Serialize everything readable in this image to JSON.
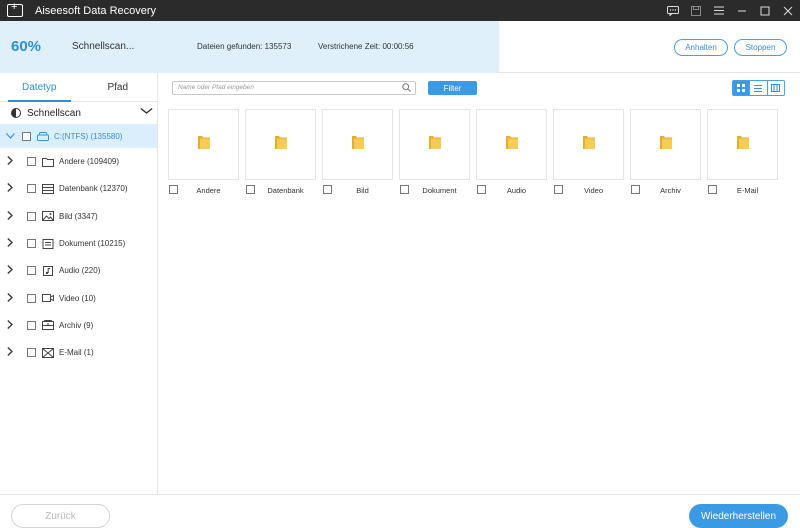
{
  "app": {
    "title": "Aiseesoft Data Recovery"
  },
  "scan": {
    "percent_label": "60%",
    "progress": 0.6,
    "status": "Schnellscan...",
    "found": "Dateien gefunden: 135573",
    "elapsed": "Verstrichene Zeit: 00:00:56",
    "pause_label": "Anhalten",
    "stop_label": "Stoppen"
  },
  "sidebar": {
    "tabs": [
      {
        "label": "Datetyp",
        "active": true
      },
      {
        "label": "Pfad",
        "active": false
      }
    ],
    "scan_mode": "Schnellscan",
    "drive": "C:(NTFS) (135580)",
    "items": [
      {
        "label": "Andere (109409)",
        "icon": "folder-icon"
      },
      {
        "label": "Datenbank (12370)",
        "icon": "database-icon"
      },
      {
        "label": "Bild (3347)",
        "icon": "image-icon"
      },
      {
        "label": "Dokument (10215)",
        "icon": "document-icon"
      },
      {
        "label": "Audio (220)",
        "icon": "audio-icon"
      },
      {
        "label": "Video (10)",
        "icon": "video-icon"
      },
      {
        "label": "Archiv (9)",
        "icon": "archive-icon"
      },
      {
        "label": "E-Mail (1)",
        "icon": "email-icon"
      }
    ]
  },
  "toolbar": {
    "search_placeholder": "Name oder Pfad eingeben",
    "filter_label": "Filter"
  },
  "tiles": [
    {
      "label": "Andere"
    },
    {
      "label": "Datenbank"
    },
    {
      "label": "Bild"
    },
    {
      "label": "Dokument"
    },
    {
      "label": "Audio"
    },
    {
      "label": "Video"
    },
    {
      "label": "Archiv"
    },
    {
      "label": "E-Mail"
    }
  ],
  "footer": {
    "back_label": "Zurück",
    "recover_label": "Wiederherstellen"
  },
  "colors": {
    "accent": "#3a9ae3",
    "progress_bg": "#dff0fb",
    "folder": "#f3c34a"
  }
}
